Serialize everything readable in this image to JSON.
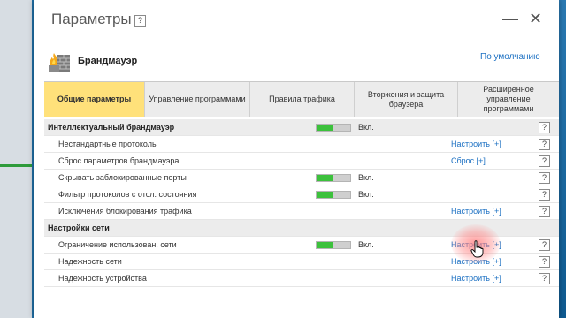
{
  "window": {
    "title": "Параметры",
    "help": "?",
    "minimize": "—",
    "close": "✕"
  },
  "header": {
    "section_title": "Брандмауэр",
    "defaults_link": "По умолчанию",
    "icon": "firewall-icon"
  },
  "tabs": [
    {
      "label": "Общие параметры",
      "active": true
    },
    {
      "label": "Управление программами",
      "active": false
    },
    {
      "label": "Правила трафика",
      "active": false
    },
    {
      "label": "Вторжения и защита браузера",
      "active": false
    },
    {
      "label": "Расширенное управление программами",
      "active": false
    }
  ],
  "rows": [
    {
      "type": "group",
      "label": "Интеллектуальный брандмауэр",
      "toggle": 0.45,
      "state": "Вкл.",
      "help": "?"
    },
    {
      "type": "item",
      "label": "Нестандартные протоколы",
      "config": "Настроить [+]",
      "help": "?"
    },
    {
      "type": "item",
      "label": "Сброс параметров брандмауэра",
      "config": "Сброс [+]",
      "help": "?"
    },
    {
      "type": "item",
      "label": "Скрывать заблокированные порты",
      "toggle": 0.45,
      "state": "Вкл.",
      "help": "?"
    },
    {
      "type": "item",
      "label": "Фильтр протоколов с отсл. состояния",
      "toggle": 0.45,
      "state": "Вкл.",
      "help": "?"
    },
    {
      "type": "item",
      "label": "Исключения блокирования трафика",
      "config": "Настроить [+]",
      "help": "?"
    },
    {
      "type": "group",
      "label": "Настройки сети"
    },
    {
      "type": "item",
      "label": "Ограничение использован. сети",
      "toggle": 0.45,
      "state": "Вкл.",
      "config": "Настроить [+]",
      "help": "?"
    },
    {
      "type": "item",
      "label": "Надежность сети",
      "config": "Настроить [+]",
      "help": "?"
    },
    {
      "type": "item",
      "label": "Надежность устройства",
      "config": "Настроить [+]",
      "help": "?"
    }
  ]
}
